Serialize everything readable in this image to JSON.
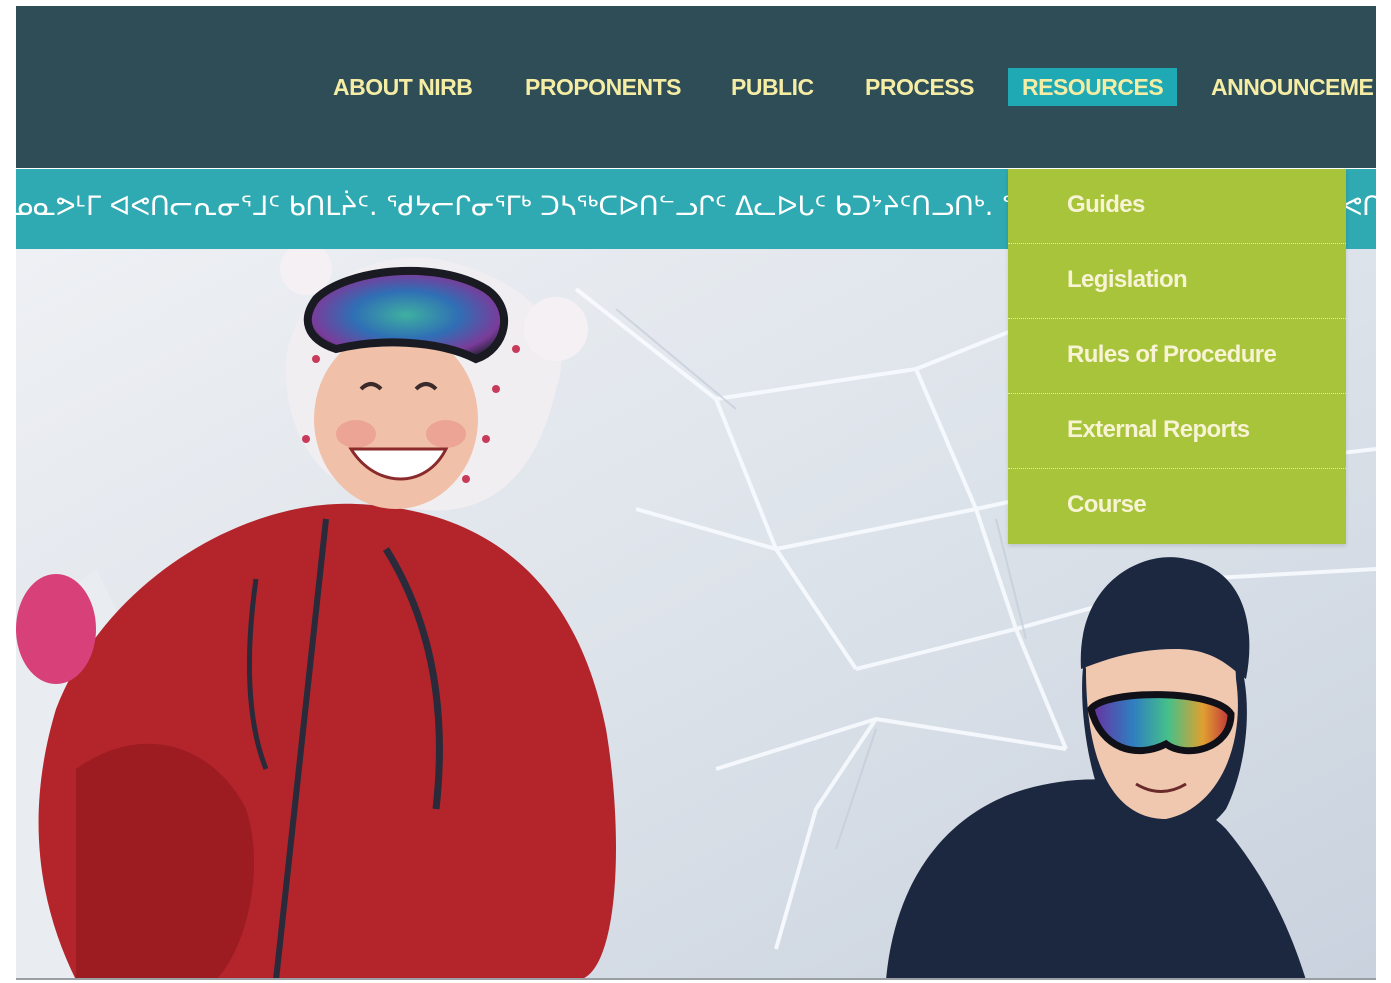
{
  "nav": {
    "items": [
      {
        "label": "ABOUT NIRB"
      },
      {
        "label": "PROPONENTS"
      },
      {
        "label": "PUBLIC"
      },
      {
        "label": "PROCESS"
      },
      {
        "label": "RESOURCES",
        "active": true
      },
      {
        "label": "ANNOUNCEME"
      }
    ]
  },
  "ticker": {
    "text": "ᓄᓇᕗᒻᒥ ᐊᕙᑎᓕᕆᓂᕐᒧᑦ ᑲᑎᒪᔩᑦ. ᖁᔭᓕᒋᓂᕐᒥᒃ ᑐᓴᖅᑕᐅᑎᓪᓗᒋᑦ ᐃᓚᐅᒐᑦ ᑲᑐᔾᔨᑦᑎᓗᑎᒃ. ᖃᔾᔮᓇᒦᒃ ᑐᓴᕆᐊᖃᕐᑕᕐᕿᔭ ᐅᕙᑎᓐᓂᒃ. | Nunavunmi Avatilirinirmut Katimayiit — Nunavut Impact Review Board | ᓄᓇᕗᒻᒥ ᐊᕙᑎᓕᕆᓂᕐᒧᑦ ᐊᐅᓚᔾᔭᐃᒋᐊᖅᑎᑦ"
  },
  "dropdown": {
    "items": [
      {
        "label": "Guides"
      },
      {
        "label": "Legislation"
      },
      {
        "label": "Rules of Procedure"
      },
      {
        "label": "External Reports"
      },
      {
        "label": "Course"
      }
    ]
  },
  "colors": {
    "navbar": "#2f4d57",
    "nav_text": "#f6eda4",
    "active_tab": "#1fa9b5",
    "ticker": "#2fa9b2",
    "dropdown": "#a7c43a",
    "dropdown_text": "#f7f3d4"
  },
  "hero": {
    "image": "photo-of-two-children-in-snow-igloo"
  }
}
